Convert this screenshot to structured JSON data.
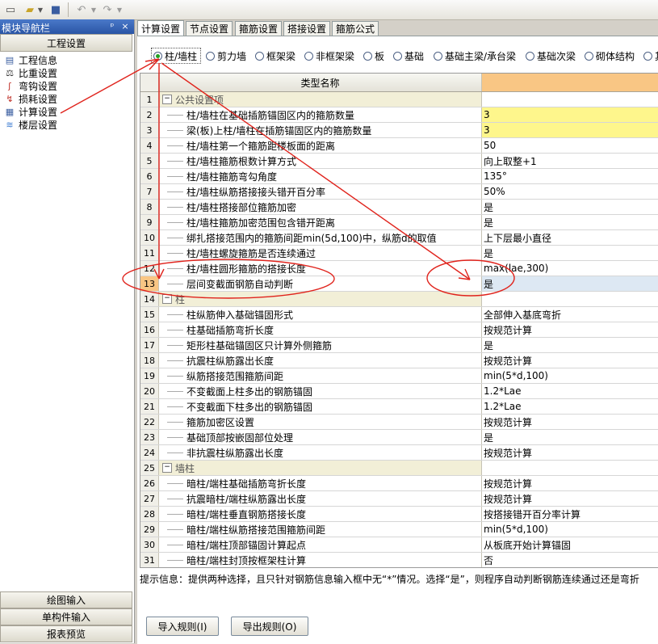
{
  "left_panel": {
    "title": "模块导航栏",
    "pin_glyph": "ᵖ",
    "close_glyph": "×",
    "project_settings": "工程设置",
    "items": [
      {
        "label": "工程信息",
        "icon": "info-icon"
      },
      {
        "label": "比重设置",
        "icon": "weight-icon"
      },
      {
        "label": "弯钩设置",
        "icon": "hook-icon"
      },
      {
        "label": "损耗设置",
        "icon": "loss-icon"
      },
      {
        "label": "计算设置",
        "icon": "calc-icon"
      },
      {
        "label": "楼层设置",
        "icon": "floor-icon"
      }
    ],
    "bottom_buttons": [
      "绘图输入",
      "单构件输入",
      "报表预览"
    ]
  },
  "tabs": [
    "计算设置",
    "节点设置",
    "箍筋设置",
    "搭接设置",
    "箍筋公式"
  ],
  "radios": [
    {
      "label": "柱/墙柱",
      "checked": true
    },
    {
      "label": "剪力墙",
      "checked": false
    },
    {
      "label": "框架梁",
      "checked": false
    },
    {
      "label": "非框架梁",
      "checked": false
    },
    {
      "label": "板",
      "checked": false
    },
    {
      "label": "基础",
      "checked": false
    },
    {
      "label": "基础主梁/承台梁",
      "checked": false
    },
    {
      "label": "基础次梁",
      "checked": false
    },
    {
      "label": "砌体结构",
      "checked": false
    },
    {
      "label": "其",
      "checked": false
    }
  ],
  "grid": {
    "header_name": "类型名称",
    "rows": [
      {
        "n": "1",
        "name": "公共设置项",
        "value": "",
        "group": true
      },
      {
        "n": "2",
        "name": "柱/墙柱在基础插筋锚固区内的箍筋数量",
        "value": "3",
        "style": "yellow"
      },
      {
        "n": "3",
        "name": "梁(板)上柱/墙柱在插筋锚固区内的箍筋数量",
        "value": "3",
        "style": "yellow"
      },
      {
        "n": "4",
        "name": "柱/墙柱第一个箍筋距楼板面的距离",
        "value": "50"
      },
      {
        "n": "5",
        "name": "柱/墙柱箍筋根数计算方式",
        "value": "向上取整+1"
      },
      {
        "n": "6",
        "name": "柱/墙柱箍筋弯勾角度",
        "value": "135°"
      },
      {
        "n": "7",
        "name": "柱/墙柱纵筋搭接接头错开百分率",
        "value": "50%"
      },
      {
        "n": "8",
        "name": "柱/墙柱搭接部位箍筋加密",
        "value": "是"
      },
      {
        "n": "9",
        "name": "柱/墙柱箍筋加密范围包含错开距离",
        "value": "是"
      },
      {
        "n": "10",
        "name": "绑扎搭接范围内的箍筋间距min(5d,100)中，纵筋d的取值",
        "value": "上下层最小直径"
      },
      {
        "n": "11",
        "name": "柱/墙柱螺旋箍筋是否连续通过",
        "value": "是"
      },
      {
        "n": "12",
        "name": "柱/墙柱圆形箍筋的搭接长度",
        "value": "max(lae,300)"
      },
      {
        "n": "13",
        "name": "层间变截面钢筋自动判断",
        "value": "是",
        "style": "sel",
        "selected": true
      },
      {
        "n": "14",
        "name": "柱",
        "value": "",
        "group": true
      },
      {
        "n": "15",
        "name": "柱纵筋伸入基础锚固形式",
        "value": "全部伸入基底弯折"
      },
      {
        "n": "16",
        "name": "柱基础插筋弯折长度",
        "value": "按规范计算"
      },
      {
        "n": "17",
        "name": "矩形柱基础锚固区只计算外侧箍筋",
        "value": "是"
      },
      {
        "n": "18",
        "name": "抗震柱纵筋露出长度",
        "value": "按规范计算"
      },
      {
        "n": "19",
        "name": "纵筋搭接范围箍筋间距",
        "value": "min(5*d,100)"
      },
      {
        "n": "20",
        "name": "不变截面上柱多出的钢筋锚固",
        "value": "1.2*Lae"
      },
      {
        "n": "21",
        "name": "不变截面下柱多出的钢筋锚固",
        "value": "1.2*Lae"
      },
      {
        "n": "22",
        "name": "箍筋加密区设置",
        "value": "按规范计算"
      },
      {
        "n": "23",
        "name": "基础顶部按嵌固部位处理",
        "value": "是"
      },
      {
        "n": "24",
        "name": "非抗震柱纵筋露出长度",
        "value": "按规范计算"
      },
      {
        "n": "25",
        "name": "墙柱",
        "value": "",
        "group": true
      },
      {
        "n": "26",
        "name": "暗柱/端柱基础插筋弯折长度",
        "value": "按规范计算"
      },
      {
        "n": "27",
        "name": "抗震暗柱/端柱纵筋露出长度",
        "value": "按规范计算"
      },
      {
        "n": "28",
        "name": "暗柱/端柱垂直钢筋搭接长度",
        "value": "按搭接错开百分率计算"
      },
      {
        "n": "29",
        "name": "暗柱/端柱纵筋搭接范围箍筋间距",
        "value": "min(5*d,100)"
      },
      {
        "n": "30",
        "name": "暗柱/端柱顶部锚固计算起点",
        "value": "从板底开始计算锚固"
      },
      {
        "n": "31",
        "name": "暗柱/端柱封顶按框架柱计算",
        "value": "否"
      }
    ]
  },
  "info_text": "提示信息：提供两种选择，且只针对钢筋信息输入框中无“*”情况。选择“是”，则程序自动判断钢筋连续通过还是弯折",
  "buttons": {
    "import": "导入规则(I)",
    "export": "导出规则(O)"
  },
  "colors": {
    "annotation": "#e0231c",
    "selected_bg": "#dde8f3",
    "yellow_cell": "#fef68c",
    "header_value_bg": "#f9c684",
    "title_bar": "#2a55a5"
  }
}
